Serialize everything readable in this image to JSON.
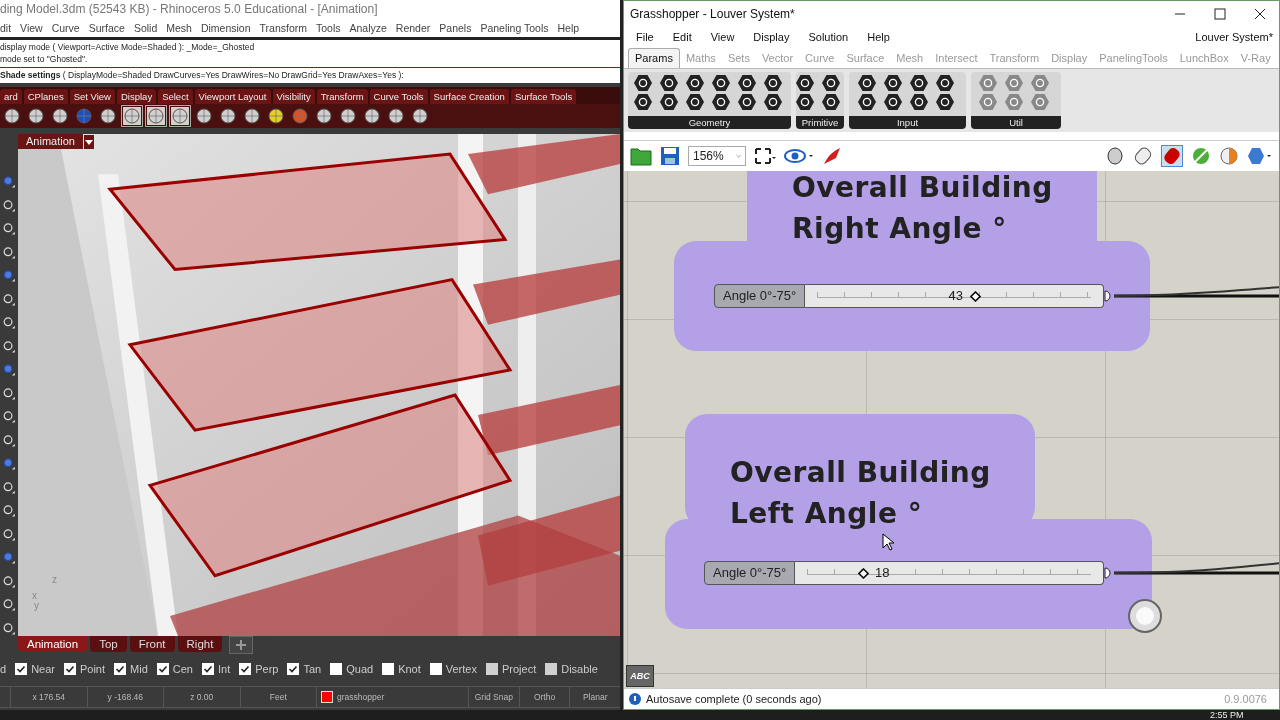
{
  "rhino": {
    "title": "ding Model.3dm (52543 KB) - Rhinoceros 5.0 Educational - [Animation]",
    "menu": [
      "dit",
      "View",
      "Curve",
      "Surface",
      "Solid",
      "Mesh",
      "Dimension",
      "Transform",
      "Tools",
      "Analyze",
      "Render",
      "Panels",
      "Paneling Tools",
      "Help"
    ],
    "history": [
      "display mode ( Viewport=Active Mode=Shaded ): _Mode=_Ghosted",
      "mode set to \"Ghosted\"."
    ],
    "prompt": "**Shade settings** ( DisplayMode=Shaded DrawCurves=Yes DrawWires=No DrawGrid=Yes DrawAxes=Yes ):",
    "toolbar_tabs": [
      "ard",
      "CPlanes",
      "Set View",
      "Display",
      "Select",
      "Viewport Layout",
      "Visibility",
      "Transform",
      "Curve Tools",
      "Surface Creation",
      "Surface Tools"
    ],
    "viewport": {
      "label": "Animation",
      "axis_labels": [
        "z",
        "x",
        "y"
      ]
    },
    "viewport_tabs": [
      {
        "label": "Animation",
        "selected": true
      },
      {
        "label": "Top",
        "selected": false
      },
      {
        "label": "Front",
        "selected": false
      },
      {
        "label": "Right",
        "selected": false
      }
    ],
    "osnap_cut_label": "d",
    "osnaps": [
      {
        "label": "Near",
        "checked": true,
        "disabled": false
      },
      {
        "label": "Point",
        "checked": true,
        "disabled": false
      },
      {
        "label": "Mid",
        "checked": true,
        "disabled": false
      },
      {
        "label": "Cen",
        "checked": true,
        "disabled": false
      },
      {
        "label": "Int",
        "checked": true,
        "disabled": false
      },
      {
        "label": "Perp",
        "checked": true,
        "disabled": false
      },
      {
        "label": "Tan",
        "checked": true,
        "disabled": false
      },
      {
        "label": "Quad",
        "checked": false,
        "disabled": false
      },
      {
        "label": "Knot",
        "checked": false,
        "disabled": false
      },
      {
        "label": "Vertex",
        "checked": false,
        "disabled": false
      },
      {
        "label": "Project",
        "checked": false,
        "disabled": true
      },
      {
        "label": "Disable",
        "checked": false,
        "disabled": true
      }
    ],
    "status": {
      "x": "x 176.54",
      "y": "y -168.46",
      "z": "z 0.00",
      "units": "Feet",
      "layer": {
        "name": "grasshopper",
        "color": "#ff0000"
      },
      "toggles": [
        "Grid Snap",
        "Ortho",
        "Planar"
      ]
    }
  },
  "grasshopper": {
    "title": "Grasshopper - Louver System*",
    "menu": [
      "File",
      "Edit",
      "View",
      "Display",
      "Solution",
      "Help"
    ],
    "doc_name": "Louver System*",
    "tabs": [
      {
        "label": "Params",
        "selected": true
      },
      {
        "label": "Maths",
        "selected": false
      },
      {
        "label": "Sets",
        "selected": false
      },
      {
        "label": "Vector",
        "selected": false
      },
      {
        "label": "Curve",
        "selected": false
      },
      {
        "label": "Surface",
        "selected": false
      },
      {
        "label": "Mesh",
        "selected": false
      },
      {
        "label": "Intersect",
        "selected": false
      },
      {
        "label": "Transform",
        "selected": false
      },
      {
        "label": "Display",
        "selected": false
      },
      {
        "label": "PanelingTools",
        "selected": false
      },
      {
        "label": "LunchBox",
        "selected": false
      },
      {
        "label": "V-Ray",
        "selected": false
      }
    ],
    "ribbon_groups": [
      "Geometry",
      "Primitive",
      "Input",
      "Util"
    ],
    "zoom": "156%",
    "groups": [
      {
        "title_lines": [
          "Overall Building",
          "Right Angle °"
        ],
        "slider": {
          "label": "Angle 0°-75°",
          "value": "43",
          "level": 0.57
        }
      },
      {
        "title_lines": [
          "Overall Building",
          "Left Angle °"
        ],
        "slider": {
          "label": "Angle 0°-75°",
          "value": "18",
          "level": 0.22
        }
      }
    ],
    "abc_button": "ABC",
    "status": "Autosave complete (0 seconds ago)",
    "version": "0.9.0076"
  },
  "taskbar": {
    "time": "2:55 PM"
  }
}
